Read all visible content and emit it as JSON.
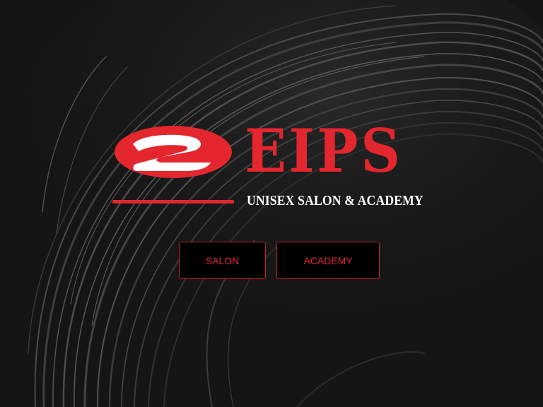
{
  "brand": {
    "name": "EIPS",
    "tagline": "UNISEX SALON & ACADEMY",
    "accent_color": "#e4262e"
  },
  "nav": {
    "buttons": [
      {
        "label": "SALON"
      },
      {
        "label": "ACADEMY"
      }
    ]
  },
  "background": {
    "color": "#151515",
    "image": "hair-strands"
  }
}
